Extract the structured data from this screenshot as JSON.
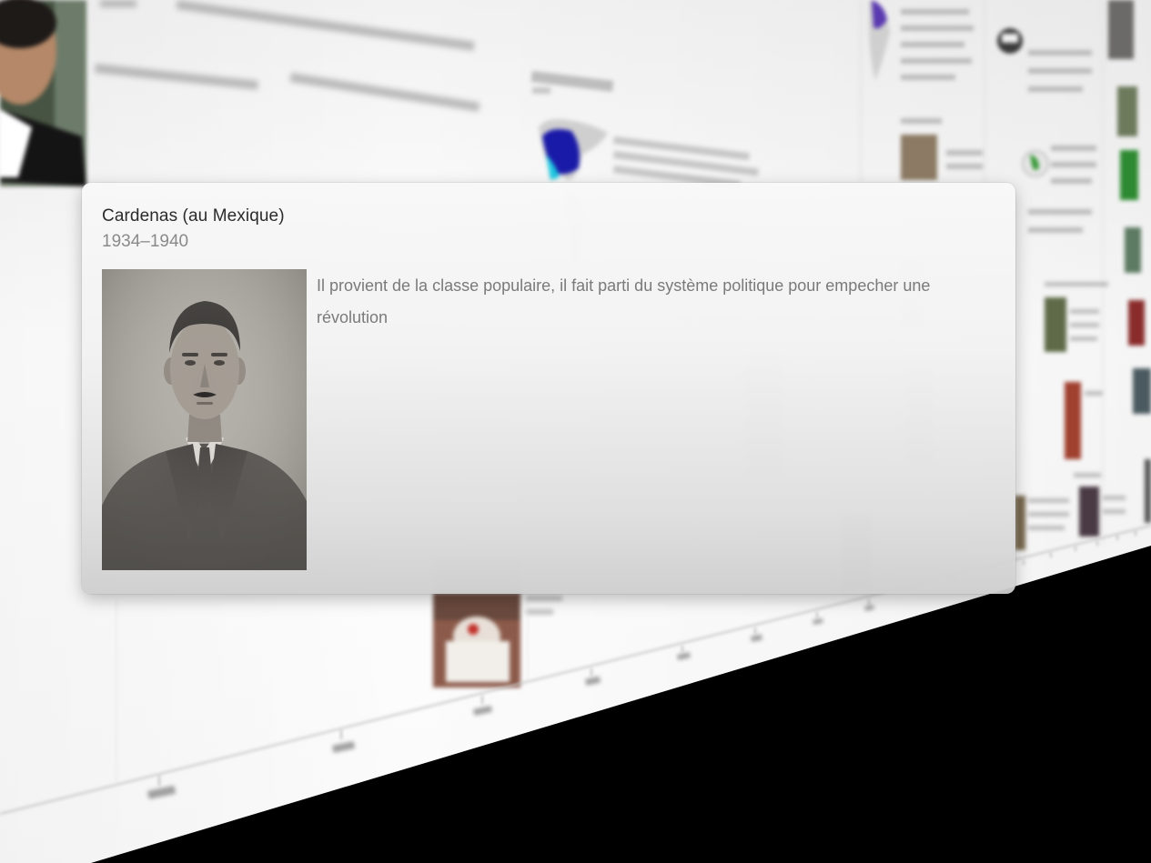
{
  "popup": {
    "title": "Cardenas (au Mexique)",
    "dates": "1934–1940",
    "description": "Il provient de la classe populaire, il fait parti du système politique pour empecher une révolution",
    "photo": "portrait-photo"
  },
  "colors": {
    "background": "#000000",
    "wall": "#f7f7f7",
    "title_text": "#2b2b2b",
    "muted_text": "#8a8a8a",
    "map_blue": "#1a1aa8",
    "map_cyan": "#1ec8e0"
  }
}
